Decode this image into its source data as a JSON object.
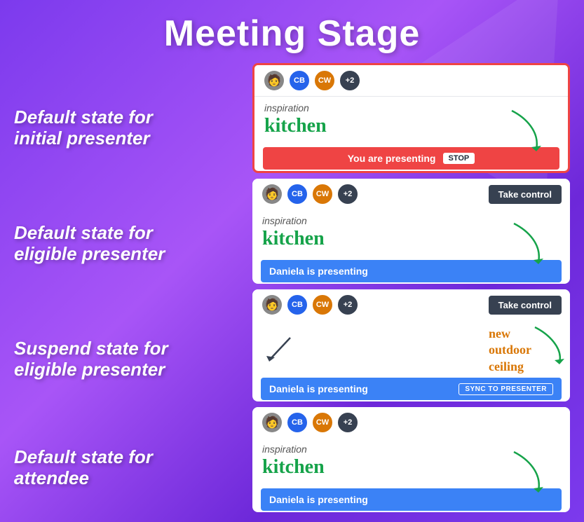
{
  "title": "Meeting Stage",
  "states": [
    {
      "label_line1": "Default state for",
      "label_line2": "initial presenter",
      "card": {
        "avatars": [
          {
            "type": "photo",
            "initials": "👤",
            "color": "#888"
          },
          {
            "type": "initials",
            "initials": "CB",
            "color": "#2563eb"
          },
          {
            "type": "initials",
            "initials": "CW",
            "color": "#d97706"
          },
          {
            "type": "plus",
            "initials": "+2",
            "color": "#374151"
          }
        ],
        "has_take_control": false,
        "content_type": "kitchen",
        "inspiration": "inspiration",
        "main_text": "kitchen",
        "footer_type": "presenting_stop",
        "footer_text": "You are presenting",
        "footer_action": "STOP",
        "border": "red"
      }
    },
    {
      "label_line1": "Default state for",
      "label_line2": "eligible presenter",
      "card": {
        "avatars": [
          {
            "type": "photo",
            "initials": "👤",
            "color": "#888"
          },
          {
            "type": "initials",
            "initials": "CB",
            "color": "#2563eb"
          },
          {
            "type": "initials",
            "initials": "CW",
            "color": "#d97706"
          },
          {
            "type": "plus",
            "initials": "+2",
            "color": "#374151"
          }
        ],
        "has_take_control": true,
        "take_control_label": "Take control",
        "content_type": "kitchen",
        "inspiration": "inspiration",
        "main_text": "kitchen",
        "footer_type": "presenting",
        "footer_text": "Daniela is presenting",
        "border": "none"
      }
    },
    {
      "label_line1": "Suspend state for",
      "label_line2": "eligible presenter",
      "card": {
        "avatars": [
          {
            "type": "photo",
            "initials": "👤",
            "color": "#888"
          },
          {
            "type": "initials",
            "initials": "CB",
            "color": "#2563eb"
          },
          {
            "type": "initials",
            "initials": "CW",
            "color": "#d97706"
          },
          {
            "type": "plus",
            "initials": "+2",
            "color": "#374151"
          }
        ],
        "has_take_control": true,
        "take_control_label": "Take control",
        "content_type": "handwriting",
        "handwriting_lines": [
          "new",
          "outdoor",
          "ceiling"
        ],
        "footer_type": "presenting_sync",
        "footer_text": "Daniela is presenting",
        "footer_action": "SYNC TO PRESENTER",
        "border": "none"
      }
    },
    {
      "label_line1": "Default state for",
      "label_line2": "attendee",
      "card": {
        "avatars": [
          {
            "type": "photo",
            "initials": "👤",
            "color": "#888"
          },
          {
            "type": "initials",
            "initials": "CB",
            "color": "#2563eb"
          },
          {
            "type": "initials",
            "initials": "CW",
            "color": "#d97706"
          },
          {
            "type": "plus",
            "initials": "+2",
            "color": "#374151"
          }
        ],
        "has_take_control": false,
        "content_type": "kitchen",
        "inspiration": "inspiration",
        "main_text": "kitchen",
        "footer_type": "presenting",
        "footer_text": "Daniela is presenting",
        "border": "none"
      }
    }
  ]
}
